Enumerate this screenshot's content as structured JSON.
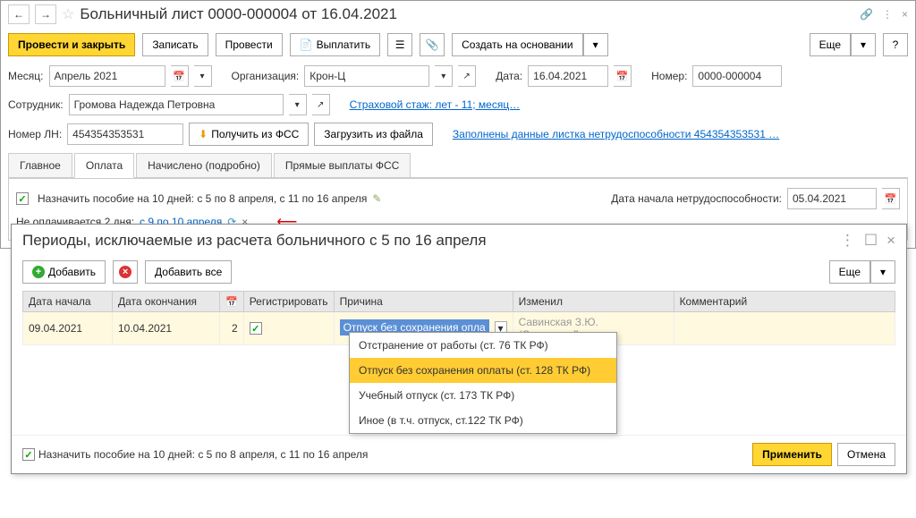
{
  "header": {
    "title": "Больничный лист 0000-000004 от 16.04.2021"
  },
  "toolbar": {
    "post_close": "Провести и закрыть",
    "save": "Записать",
    "post": "Провести",
    "pay": "Выплатить",
    "create_based": "Создать на основании",
    "more": "Еще"
  },
  "form": {
    "month_label": "Месяц:",
    "month_value": "Апрель 2021",
    "org_label": "Организация:",
    "org_value": "Крон-Ц",
    "date_label": "Дата:",
    "date_value": "16.04.2021",
    "number_label": "Номер:",
    "number_value": "0000-000004",
    "employee_label": "Сотрудник:",
    "employee_value": "Громова Надежда Петровна",
    "insurance_link": "Страховой стаж: лет - 11; месяц…",
    "ln_label": "Номер ЛН:",
    "ln_value": "454354353531",
    "get_fss": "Получить из ФСС",
    "load_file": "Загрузить из файла",
    "fss_link": "Заполнены данные листка нетрудоспособности 454354353531 …"
  },
  "tabs": {
    "main": "Главное",
    "payment": "Оплата",
    "accrued": "Начислено (подробно)",
    "direct": "Прямые выплаты ФСС"
  },
  "payment": {
    "assign_text": "Назначить пособие на 10 дней: с 5 по 8 апреля, с 11 по 16 апреля",
    "start_label": "Дата начала нетрудоспособности:",
    "start_value": "05.04.2021",
    "unpaid_text": "Не оплачивается 2 дня:",
    "unpaid_link": "с 9 по 10 апреля"
  },
  "dialog": {
    "title": "Периоды, исключаемые из расчета больничного с 5 по 16 апреля",
    "add": "Добавить",
    "add_all": "Добавить все",
    "more": "Еще",
    "cols": {
      "start": "Дата начала",
      "end": "Дата окончания",
      "register": "Регистрировать",
      "reason": "Причина",
      "changed": "Изменил",
      "comment": "Комментарий"
    },
    "row": {
      "start": "09.04.2021",
      "end": "10.04.2021",
      "days": "2",
      "reason": "Отпуск без сохранения опла",
      "changed": "Савинская З.Ю. (Системный…"
    },
    "footer_text": "Назначить пособие на 10 дней: с 5 по 8 апреля, с 11 по 16 апреля",
    "apply": "Применить",
    "cancel": "Отмена"
  },
  "dropdown": {
    "opt1": "Отстранение от работы (ст. 76 ТК РФ)",
    "opt2": "Отпуск без сохранения оплаты (ст. 128 ТК РФ)",
    "opt3": "Учебный отпуск (ст. 173 ТК РФ)",
    "opt4": "Иное (в т.ч. отпуск, ст.122 ТК РФ)"
  }
}
